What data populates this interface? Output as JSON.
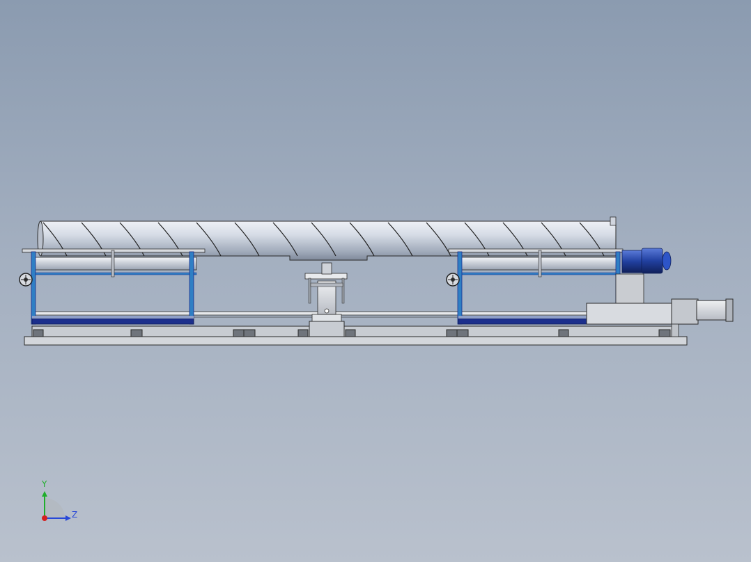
{
  "viewport": {
    "background_top": "#8b9bb0",
    "background_bottom": "#b9c1cd",
    "model_colors": {
      "pipe": "#c9d0dc",
      "frame_blue": "#2f7fc4",
      "dark_blue": "#1c2f8c",
      "motor_blue": "#2140a0",
      "base_gray": "#d3d6db",
      "edge": "#2a2a2a"
    }
  },
  "triad": {
    "y_label": "Y",
    "z_label": "Z",
    "y_color": "#1fae2b",
    "z_color": "#2848d8",
    "x_color": "#d42020"
  }
}
